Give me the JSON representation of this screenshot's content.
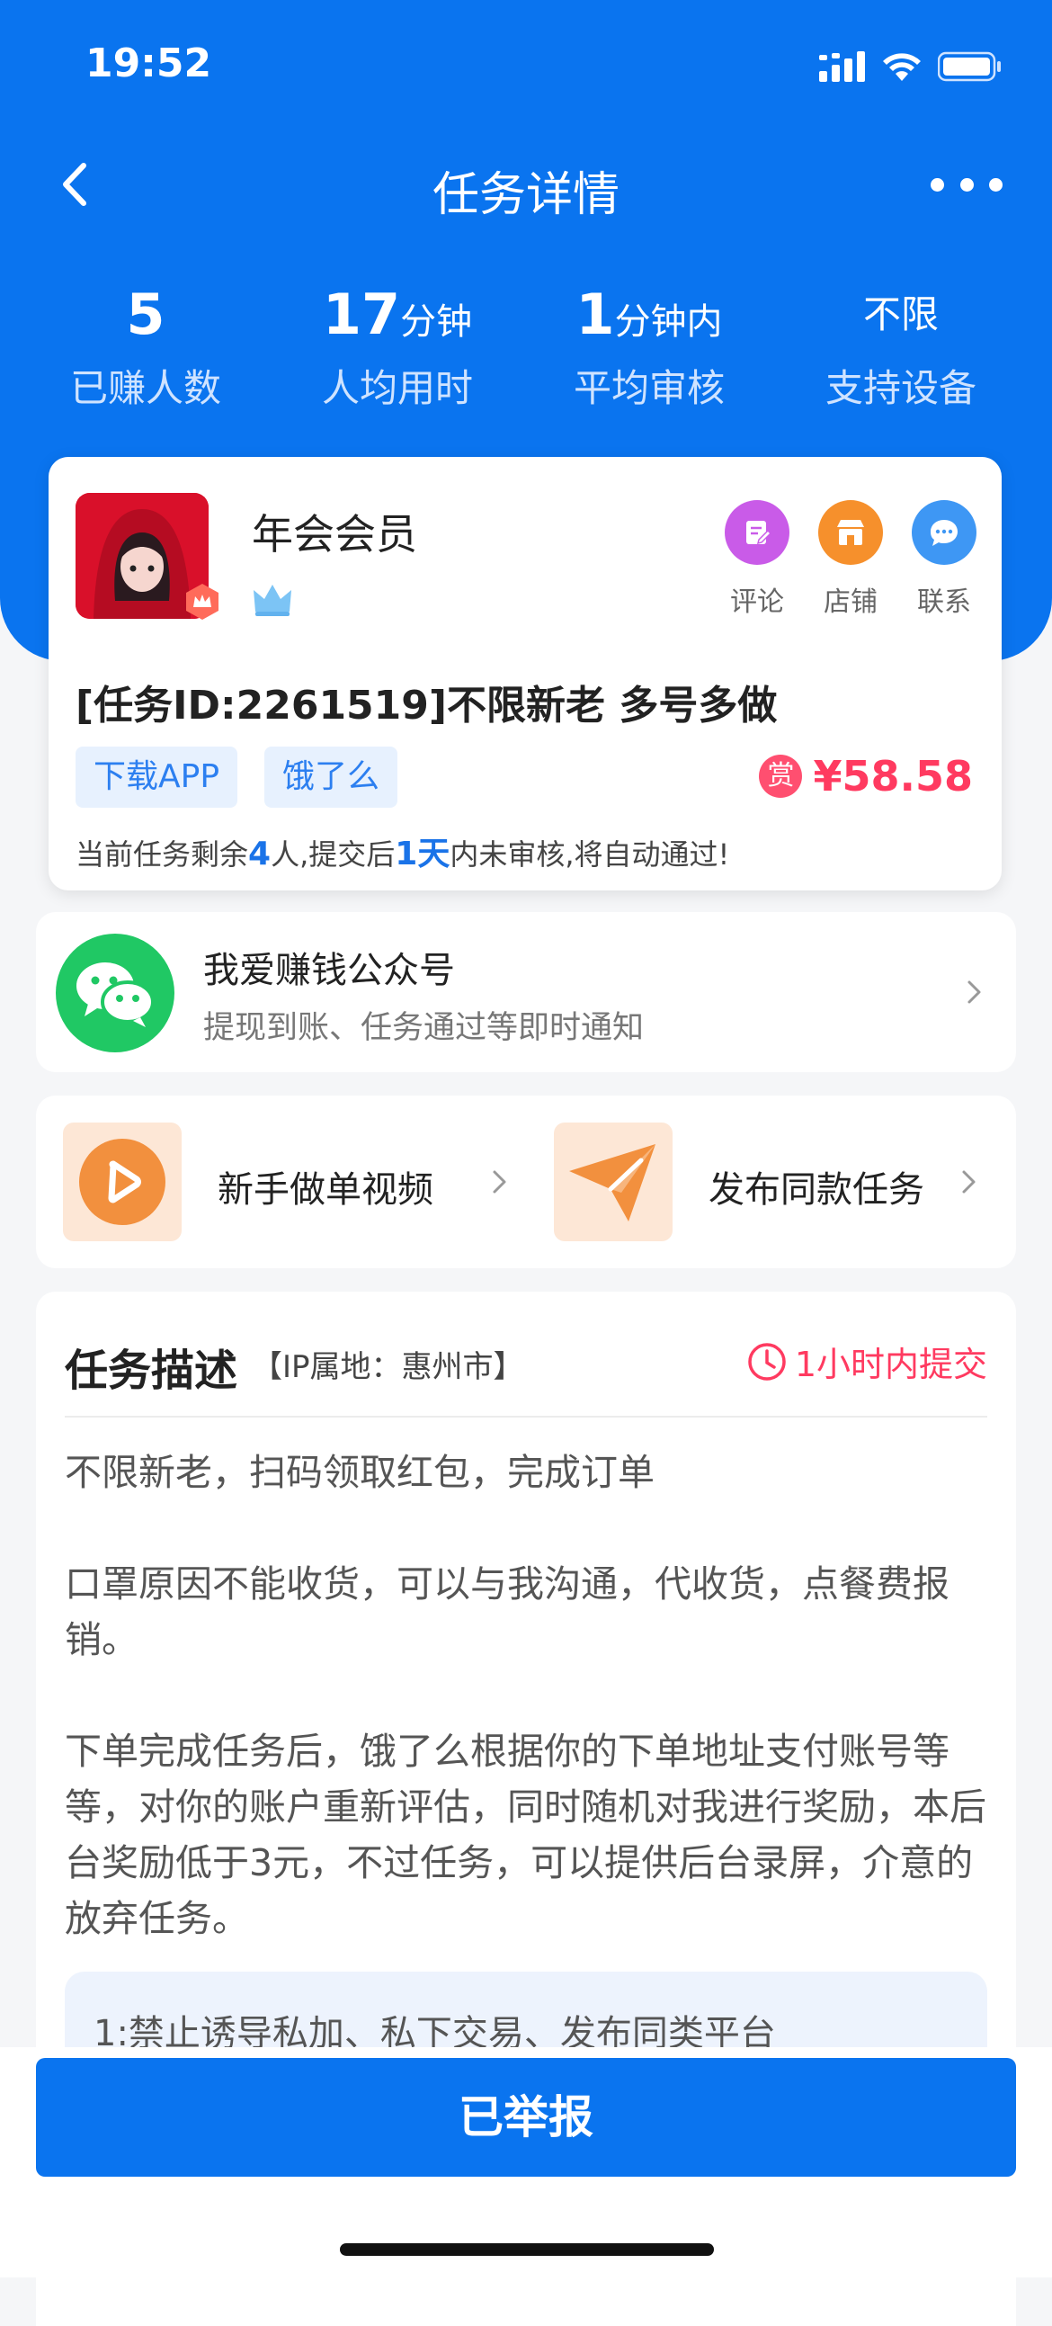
{
  "status_bar": {
    "time": "19:52"
  },
  "nav": {
    "title": "任务详情"
  },
  "stats": [
    {
      "num": "5",
      "unit": "",
      "label": "已赚人数"
    },
    {
      "num": "17",
      "unit": "分钟",
      "label": "人均用时"
    },
    {
      "num": "1",
      "unit": "分钟内",
      "label": "平均审核"
    },
    {
      "text": "不限",
      "label": "支持设备"
    }
  ],
  "task": {
    "publisher_name": "年会会员",
    "actions": {
      "comment": "评论",
      "shop": "店铺",
      "contact": "联系"
    },
    "title": "[任务ID:2261519]不限新老 多号多做",
    "tags": [
      "下载APP",
      "饿了么"
    ],
    "reward_icon": "赏",
    "reward": "¥58.58",
    "remain_prefix": "当前任务剩余",
    "remain_count": "4",
    "remain_mid": "人,提交后",
    "remain_days": "1天",
    "remain_suffix": "内未审核,将自动通过!"
  },
  "wechat": {
    "title": "我爱赚钱公众号",
    "subtitle": "提现到账、任务通过等即时通知"
  },
  "guides": {
    "video": "新手做单视频",
    "publish": "发布同款任务"
  },
  "description": {
    "title": "任务描述",
    "ip": "【IP属地：惠州市】",
    "deadline": "1小时内提交",
    "body": "不限新老，扫码领取红包，完成订单\n\n口罩原因不能收货，可以与我沟通，代收货，点餐费报销。\n\n下单完成任务后，饿了么根据你的下单地址支付账号等等，对你的账户重新评估，同时随机对我进行奖励，本后台奖励低于3元，不过任务，可以提供后台录屏，介意的放弃任务。",
    "rules_first": "1:禁止诱导私加、私下交易、发布同类平台"
  },
  "bottom": {
    "button": "已举报"
  },
  "colors": {
    "primary": "#0a74ef",
    "reward": "#ff3a60",
    "wechat": "#20c864"
  }
}
